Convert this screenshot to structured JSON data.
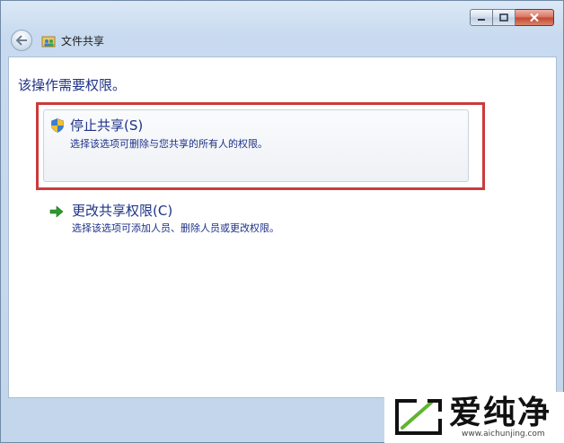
{
  "window": {
    "title": "文件共享",
    "caption_buttons": [
      "minimize-icon",
      "maximize-icon",
      "close-icon"
    ]
  },
  "content": {
    "heading": "该操作需要权限。",
    "options": [
      {
        "title": "停止共享(S)",
        "description": "选择该选项可删除与您共享的所有人的权限。",
        "icon": "shield-icon",
        "highlighted": true
      },
      {
        "title": "更改共享权限(C)",
        "description": "选择该选项可添加人员、删除人员或更改权限。",
        "icon": "green-arrow-icon",
        "highlighted": false
      }
    ]
  },
  "watermark": {
    "brand": "爱纯净",
    "url": "www.aichunjing.com"
  },
  "colors": {
    "link_blue": "#1e3287",
    "highlight_red": "#cb3b3b",
    "arrow_green": "#2e9a2e"
  }
}
